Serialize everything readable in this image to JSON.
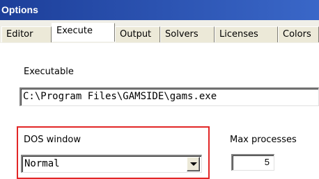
{
  "window": {
    "title": "Options"
  },
  "tabs": [
    {
      "label": "Editor"
    },
    {
      "label": "Execute",
      "active": true
    },
    {
      "label": "Output"
    },
    {
      "label": "Solvers"
    },
    {
      "label": "Licenses"
    },
    {
      "label": "Colors"
    }
  ],
  "execute": {
    "executable_label": "Executable",
    "executable_value": "C:\\Program Files\\GAMSIDE\\gams.exe",
    "dos_window_label": "DOS window",
    "dos_window_value": "Normal",
    "max_processes_label": "Max processes",
    "max_processes_value": "5"
  },
  "colors": {
    "highlight": "#e22626",
    "titlebar": "#2b4fa3"
  },
  "icons": {
    "dropdown": "chevron-down-icon"
  }
}
